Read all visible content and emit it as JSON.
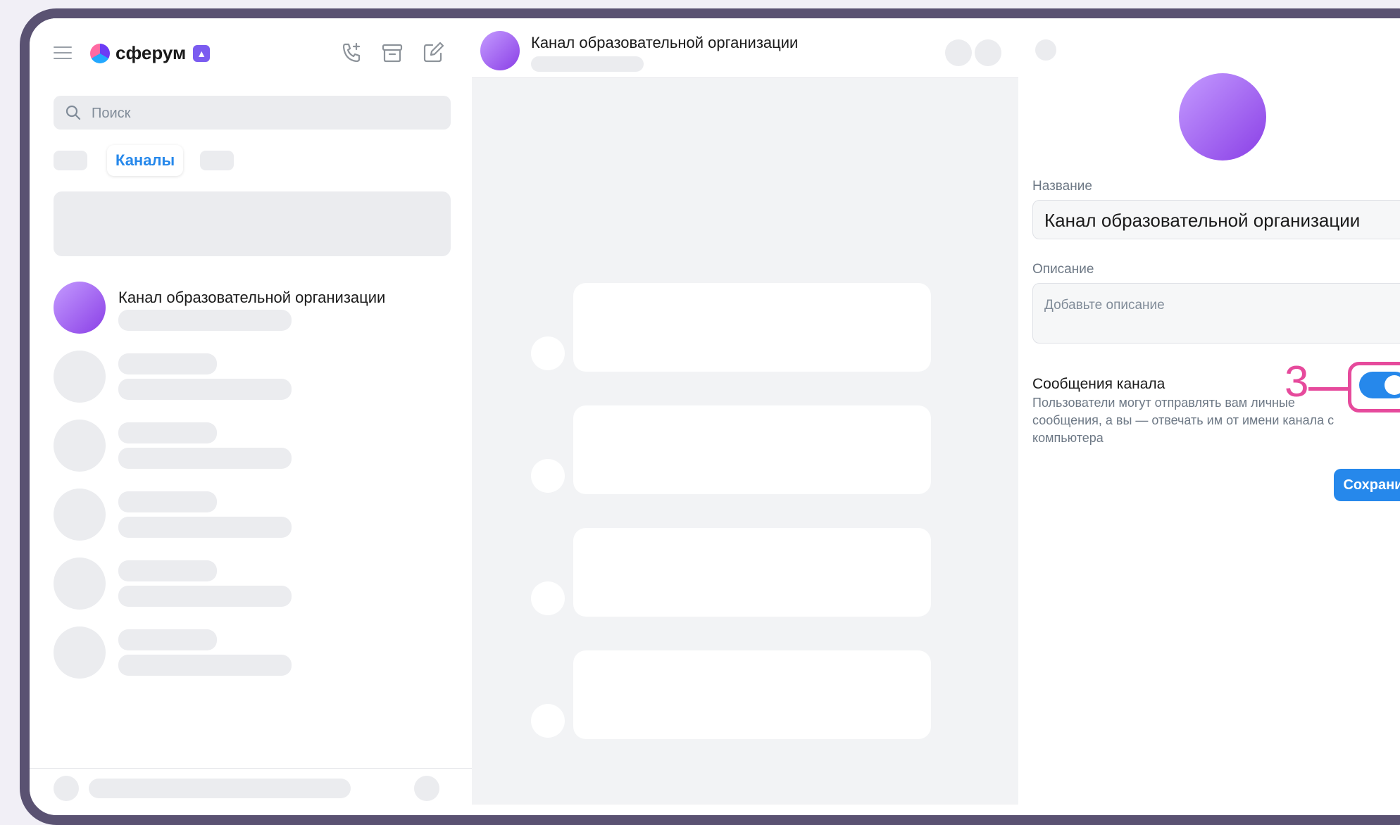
{
  "app": {
    "name": "сферум"
  },
  "search": {
    "placeholder": "Поиск"
  },
  "tabs": {
    "active_label": "Каналы"
  },
  "chat_list": {
    "first_item_title": "Канал образовательной организации"
  },
  "conversation": {
    "title": "Канал образовательной организации"
  },
  "settings": {
    "name_label": "Название",
    "name_value": "Канал образовательной организации",
    "description_label": "Описание",
    "description_placeholder": "Добавьте описание",
    "messages_title": "Сообщения канала",
    "messages_description": "Пользователи могут отправлять вам личные сообщения, а вы — отвечать им от имени канала с компьютера",
    "messages_enabled": true,
    "save_label": "Сохранить"
  },
  "annotation": {
    "number": "3",
    "color": "#e64a9c"
  },
  "colors": {
    "accent": "#2688eb",
    "frame": "#5a5272"
  }
}
